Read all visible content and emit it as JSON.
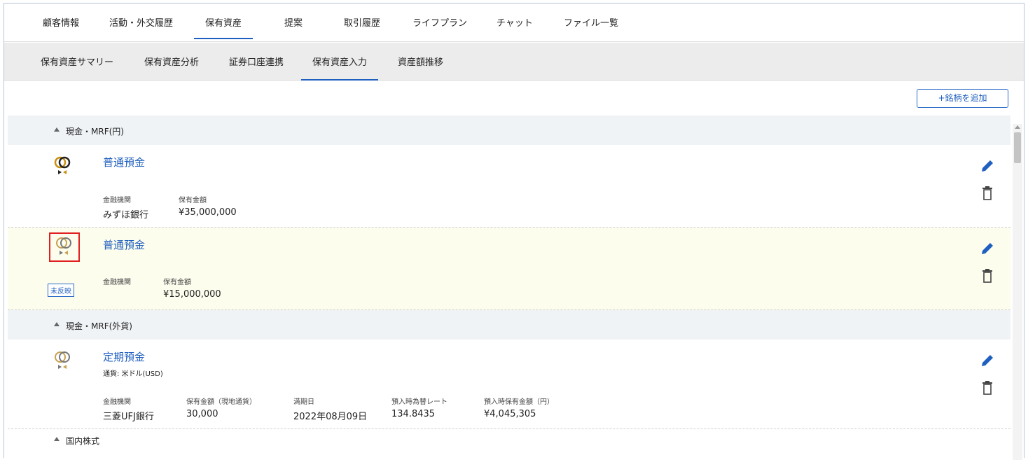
{
  "tabs_primary": [
    "顧客情報",
    "活動・外交履歴",
    "保有資産",
    "提案",
    "取引履歴",
    "ライフプラン",
    "チャット",
    "ファイル一覧"
  ],
  "tabs_secondary": [
    "保有資産サマリー",
    "保有資産分析",
    "証券口座連携",
    "保有資産入力",
    "資産額推移"
  ],
  "add_button": "+銘柄を追加",
  "categories": {
    "cash_jpy": "現金・MRF(円)",
    "cash_fx": "現金・MRF(外貨)",
    "domestic_stock": "国内株式"
  },
  "items": [
    {
      "name": "普通預金",
      "labels": [
        "金融機関",
        "保有金額"
      ],
      "values": [
        "みずほ銀行",
        "¥35,000,000"
      ]
    },
    {
      "name": "普通預金",
      "badge": "未反映",
      "labels": [
        "金融機関",
        "保有金額"
      ],
      "values": [
        "",
        "¥15,000,000"
      ]
    },
    {
      "name": "定期預金",
      "sub": "通貨: 米ドル(USD)",
      "labels": [
        "金融機関",
        "保有金額（現地通貨）",
        "満期日",
        "預入時為替レート",
        "預入時保有金額（円）"
      ],
      "values": [
        "三菱UFJ銀行",
        "30,000",
        "2022年08月09日",
        "134.8435",
        "¥4,045,305"
      ]
    }
  ],
  "colors": {
    "accent": "#1f5fbf",
    "highlight": "#e02020",
    "pending_bg": "#fdfdee"
  },
  "icons": [
    "bank-logo-icon",
    "edit-pencil-icon",
    "trash-icon",
    "collapse-arrow-icon"
  ]
}
